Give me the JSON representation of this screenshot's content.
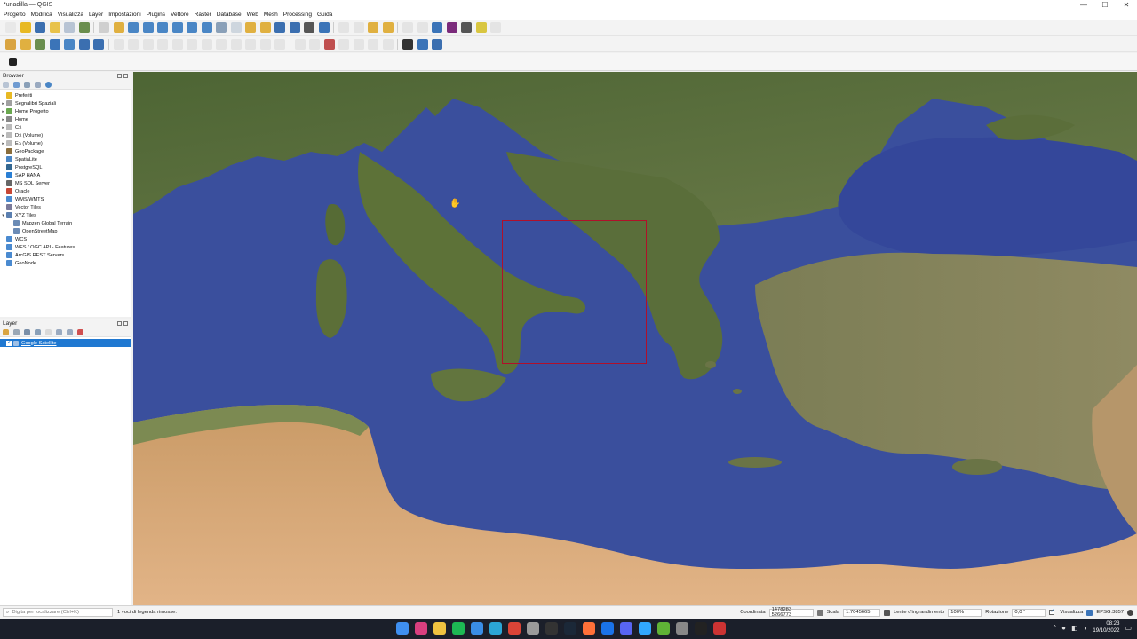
{
  "window": {
    "title": "*unadilla — QGIS",
    "controls": {
      "minimize": "—",
      "maximize": "☐",
      "close": "✕"
    }
  },
  "menu": [
    "Progetto",
    "Modifica",
    "Visualizza",
    "Layer",
    "Impostazioni",
    "Plugins",
    "Vettore",
    "Raster",
    "Database",
    "Web",
    "Mesh",
    "Processing",
    "Guida"
  ],
  "toolbar3": {
    "icon": "qgis-plugin-icon"
  },
  "browser": {
    "title": "Browser",
    "items": [
      {
        "label": "Preferiti",
        "icon": "star-icon",
        "color": "#e8b923",
        "arrow": "",
        "child": false
      },
      {
        "label": "Segnalibri Spaziali",
        "icon": "bookmark-icon",
        "color": "#a0a0a0",
        "arrow": "▸",
        "child": false
      },
      {
        "label": "Home Progetto",
        "icon": "folder-icon",
        "color": "#6aa84f",
        "arrow": "▸",
        "child": false
      },
      {
        "label": "Home",
        "icon": "home-icon",
        "color": "#888888",
        "arrow": "▸",
        "child": false
      },
      {
        "label": "C:\\",
        "icon": "drive-icon",
        "color": "#bbbbbb",
        "arrow": "▸",
        "child": false
      },
      {
        "label": "D:\\ (Volume)",
        "icon": "drive-icon",
        "color": "#bbbbbb",
        "arrow": "▸",
        "child": false
      },
      {
        "label": "E:\\ (Volume)",
        "icon": "drive-icon",
        "color": "#bbbbbb",
        "arrow": "▸",
        "child": false
      },
      {
        "label": "GeoPackage",
        "icon": "geopackage-icon",
        "color": "#8a6d3b",
        "arrow": "",
        "child": false
      },
      {
        "label": "SpatiaLite",
        "icon": "spatialite-icon",
        "color": "#4a86c5",
        "arrow": "",
        "child": false
      },
      {
        "label": "PostgreSQL",
        "icon": "postgresql-icon",
        "color": "#336791",
        "arrow": "",
        "child": false
      },
      {
        "label": "SAP HANA",
        "icon": "sap-hana-icon",
        "color": "#2a7fd4",
        "arrow": "",
        "child": false
      },
      {
        "label": "MS SQL Server",
        "icon": "mssql-icon",
        "color": "#666666",
        "arrow": "",
        "child": false
      },
      {
        "label": "Oracle",
        "icon": "oracle-icon",
        "color": "#c74634",
        "arrow": "",
        "child": false
      },
      {
        "label": "WMS/WMTS",
        "icon": "wms-icon",
        "color": "#4a8ad0",
        "arrow": "",
        "child": false
      },
      {
        "label": "Vector Tiles",
        "icon": "vector-tiles-icon",
        "color": "#7a7a9a",
        "arrow": "",
        "child": false
      },
      {
        "label": "XYZ Tiles",
        "icon": "xyz-tiles-icon",
        "color": "#5b7fb0",
        "arrow": "▾",
        "child": false
      },
      {
        "label": "Mapzen Global Terrain",
        "icon": "tile-grid-icon",
        "color": "#6b8bb5",
        "arrow": "",
        "child": true
      },
      {
        "label": "OpenStreetMap",
        "icon": "tile-grid-icon",
        "color": "#6b8bb5",
        "arrow": "",
        "child": true
      },
      {
        "label": "WCS",
        "icon": "wcs-icon",
        "color": "#4a8ad0",
        "arrow": "",
        "child": false
      },
      {
        "label": "WFS / OGC API - Features",
        "icon": "wfs-icon",
        "color": "#4a8ad0",
        "arrow": "",
        "child": false
      },
      {
        "label": "ArcGIS REST Servers",
        "icon": "arcgis-icon",
        "color": "#4a8ad0",
        "arrow": "",
        "child": false
      },
      {
        "label": "GeoNode",
        "icon": "geonode-icon",
        "color": "#4a8ad0",
        "arrow": "",
        "child": false
      }
    ]
  },
  "layers": {
    "title": "Layer",
    "items": [
      {
        "label": "Google Satellite",
        "checked": true,
        "selected": true
      }
    ]
  },
  "statusbar": {
    "locator_placeholder": "Digita per localizzare (Ctrl+K)",
    "message": "1 voci di legenda rimosse.",
    "coord_label": "Coordinata",
    "coord_value": "1478283 5266773",
    "scale_label": "Scala",
    "scale_value": "1:7045665",
    "magnifier_label": "Lente d'ingrandimento",
    "magnifier_value": "100%",
    "rotation_label": "Rotazione",
    "rotation_value": "0,0 °",
    "render_label": "Visualizza",
    "crs": "EPSG:3857"
  },
  "taskbar": {
    "apps": [
      "windows-start-icon",
      "instagram-icon",
      "file-explorer-icon",
      "spotify-icon",
      "mail-icon",
      "edge-icon",
      "chrome-icon",
      "app-icon",
      "inkscape-icon",
      "steam-icon",
      "firefox-icon",
      "chrome-canary-icon",
      "discord-icon",
      "photoshop-icon",
      "qgis-icon",
      "settings-icon",
      "github-icon",
      "app2-icon"
    ],
    "app_colors": [
      "#3f8ff0",
      "#d93f7f",
      "#f0c340",
      "#1db954",
      "#3a8ee6",
      "#2ba6d6",
      "#db4437",
      "#9a9a9a",
      "#333333",
      "#1b2838",
      "#ff7139",
      "#1a73e8",
      "#5865f2",
      "#31a8ff",
      "#5fb336",
      "#888888",
      "#222222",
      "#cc3333"
    ],
    "time": "08:23",
    "date": "19/10/2022"
  },
  "map": {
    "layer": "Google Satellite",
    "colors": {
      "sea": "#3b4f9c",
      "deep_sea": "#2f4189",
      "land": "#5a6e3a",
      "land_dark": "#3f5a2a",
      "desert": "#d8a878",
      "desert_dark": "#c8925e",
      "extent_box": "#b0102a"
    }
  }
}
